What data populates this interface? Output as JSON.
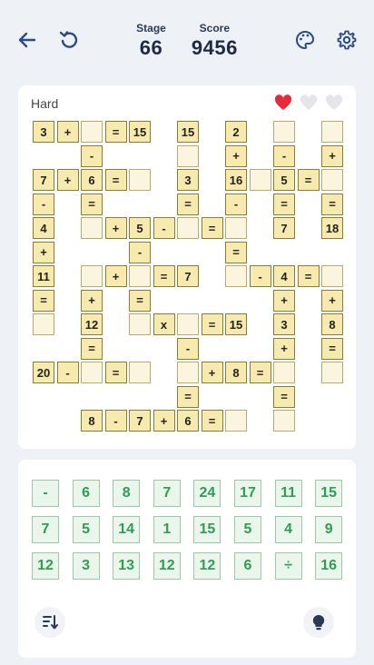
{
  "header": {
    "stage_label": "Stage",
    "stage_value": "66",
    "score_label": "Score",
    "score_value": "9456",
    "icons": [
      "back-arrow-icon",
      "restart-icon",
      "palette-icon",
      "settings-gear-icon"
    ]
  },
  "board": {
    "difficulty": "Hard",
    "lives": [
      {
        "state": "full",
        "color": "#e8283c"
      },
      {
        "state": "empty",
        "color": "#e4e6ea"
      },
      {
        "state": "empty",
        "color": "#e4e6ea"
      }
    ],
    "cells": [
      [
        0,
        0,
        "3"
      ],
      [
        0,
        1,
        "+"
      ],
      [
        0,
        2,
        ""
      ],
      [
        0,
        3,
        "="
      ],
      [
        0,
        4,
        "15"
      ],
      [
        0,
        6,
        "15"
      ],
      [
        0,
        8,
        "2"
      ],
      [
        0,
        10,
        ""
      ],
      [
        0,
        12,
        ""
      ],
      [
        1,
        2,
        "-"
      ],
      [
        1,
        6,
        ""
      ],
      [
        1,
        8,
        "+"
      ],
      [
        1,
        10,
        "-"
      ],
      [
        1,
        12,
        "+"
      ],
      [
        2,
        0,
        "7"
      ],
      [
        2,
        1,
        "+"
      ],
      [
        2,
        2,
        "6"
      ],
      [
        2,
        3,
        "="
      ],
      [
        2,
        4,
        ""
      ],
      [
        2,
        6,
        "3"
      ],
      [
        2,
        8,
        "16"
      ],
      [
        2,
        9,
        ""
      ],
      [
        2,
        10,
        "5"
      ],
      [
        2,
        11,
        "="
      ],
      [
        2,
        12,
        ""
      ],
      [
        3,
        0,
        "-"
      ],
      [
        3,
        2,
        "="
      ],
      [
        3,
        6,
        "="
      ],
      [
        3,
        8,
        "-"
      ],
      [
        3,
        10,
        "="
      ],
      [
        3,
        12,
        "="
      ],
      [
        4,
        0,
        "4"
      ],
      [
        4,
        2,
        ""
      ],
      [
        4,
        3,
        "+"
      ],
      [
        4,
        4,
        "5"
      ],
      [
        4,
        5,
        "-"
      ],
      [
        4,
        6,
        ""
      ],
      [
        4,
        7,
        "="
      ],
      [
        4,
        8,
        ""
      ],
      [
        4,
        10,
        "7"
      ],
      [
        4,
        12,
        "18"
      ],
      [
        5,
        0,
        "+"
      ],
      [
        5,
        4,
        "-"
      ],
      [
        5,
        8,
        "="
      ],
      [
        6,
        0,
        "11"
      ],
      [
        6,
        2,
        ""
      ],
      [
        6,
        3,
        "+"
      ],
      [
        6,
        4,
        ""
      ],
      [
        6,
        5,
        "="
      ],
      [
        6,
        6,
        "7"
      ],
      [
        6,
        8,
        ""
      ],
      [
        6,
        9,
        "-"
      ],
      [
        6,
        10,
        "4"
      ],
      [
        6,
        11,
        "="
      ],
      [
        6,
        12,
        ""
      ],
      [
        7,
        0,
        "="
      ],
      [
        7,
        2,
        "+"
      ],
      [
        7,
        4,
        "="
      ],
      [
        7,
        10,
        "+"
      ],
      [
        7,
        12,
        "+"
      ],
      [
        8,
        0,
        ""
      ],
      [
        8,
        2,
        "12"
      ],
      [
        8,
        4,
        ""
      ],
      [
        8,
        5,
        "x"
      ],
      [
        8,
        6,
        ""
      ],
      [
        8,
        7,
        "="
      ],
      [
        8,
        8,
        "15"
      ],
      [
        8,
        10,
        "3"
      ],
      [
        8,
        12,
        "8"
      ],
      [
        9,
        2,
        "="
      ],
      [
        9,
        6,
        "-"
      ],
      [
        9,
        10,
        "+"
      ],
      [
        9,
        12,
        "="
      ],
      [
        10,
        0,
        "20"
      ],
      [
        10,
        1,
        "-"
      ],
      [
        10,
        2,
        ""
      ],
      [
        10,
        3,
        "="
      ],
      [
        10,
        4,
        ""
      ],
      [
        10,
        6,
        ""
      ],
      [
        10,
        7,
        "+"
      ],
      [
        10,
        8,
        "8"
      ],
      [
        10,
        9,
        "="
      ],
      [
        10,
        10,
        ""
      ],
      [
        10,
        12,
        ""
      ],
      [
        11,
        6,
        "="
      ],
      [
        11,
        10,
        "="
      ],
      [
        12,
        2,
        "8"
      ],
      [
        12,
        3,
        "-"
      ],
      [
        12,
        4,
        "7"
      ],
      [
        12,
        5,
        "+"
      ],
      [
        12,
        6,
        "6"
      ],
      [
        12,
        7,
        "="
      ],
      [
        12,
        8,
        ""
      ],
      [
        12,
        10,
        ""
      ]
    ]
  },
  "tray": {
    "tiles": [
      [
        "-",
        "6",
        "8",
        "7",
        "24",
        "17",
        "11",
        "15"
      ],
      [
        "7",
        "5",
        "14",
        "1",
        "15",
        "5",
        "4",
        "9"
      ],
      [
        "12",
        "3",
        "13",
        "12",
        "12",
        "6",
        "÷",
        "16"
      ]
    ],
    "buttons": [
      "sort-icon",
      "hint-lightbulb-icon"
    ]
  }
}
